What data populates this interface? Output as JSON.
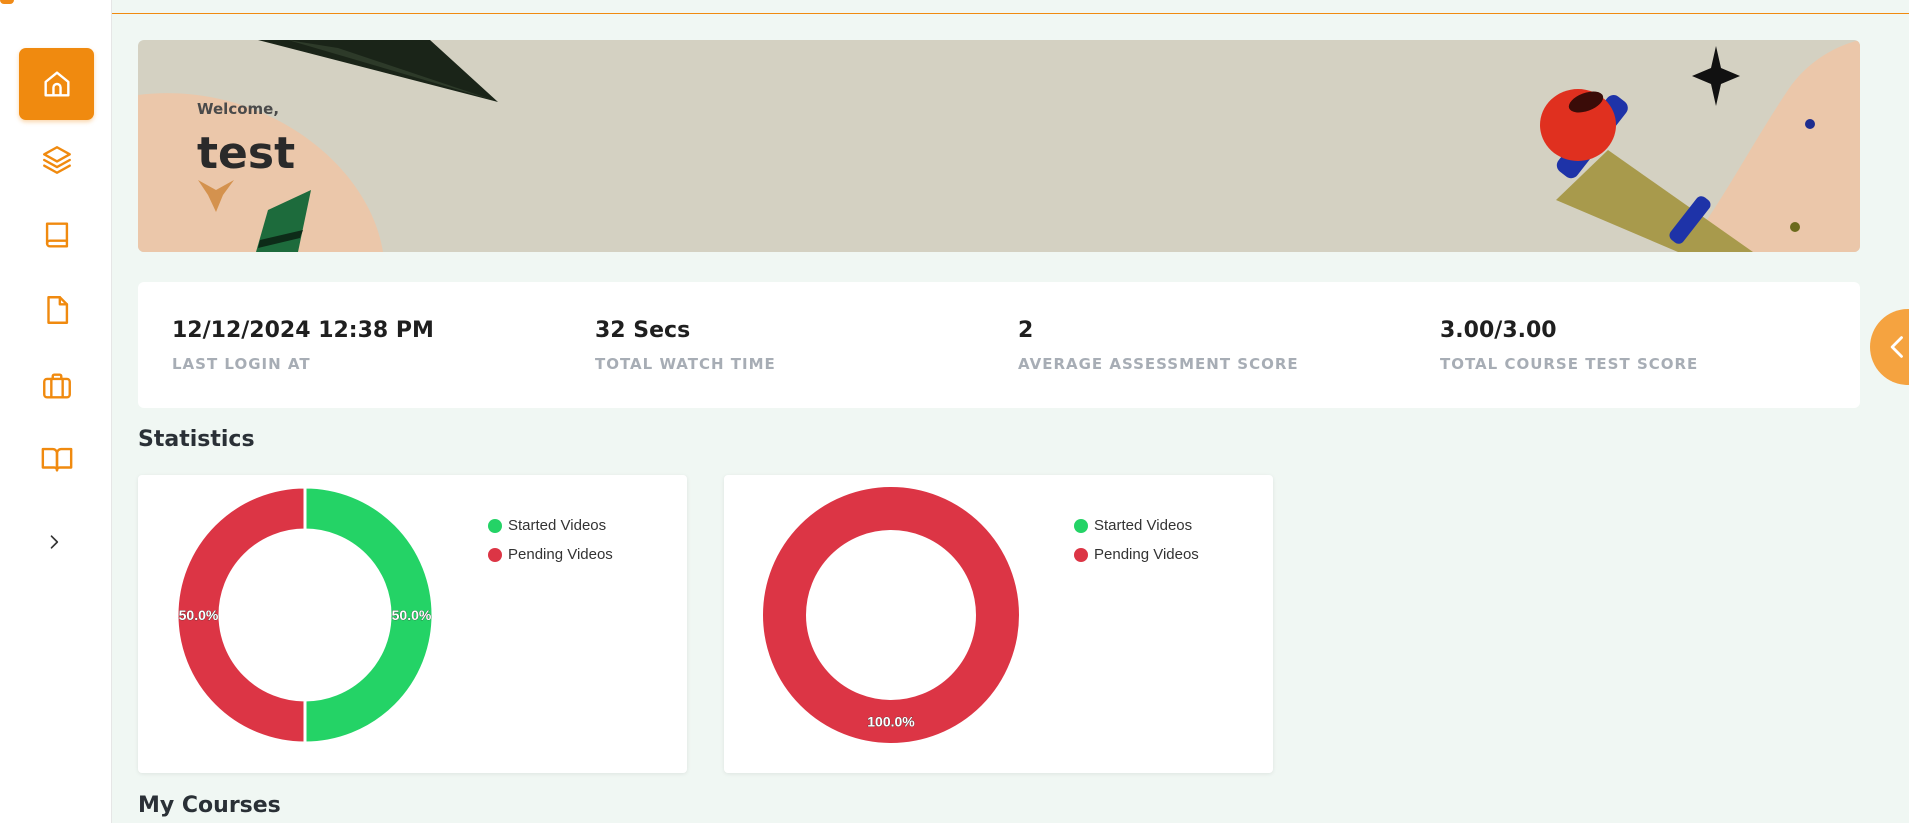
{
  "colors": {
    "accent": "#f08a0f",
    "started": "#24d366",
    "pending": "#dc3545"
  },
  "sidebar": {
    "items": [
      {
        "icon": "home-icon",
        "active": true
      },
      {
        "icon": "layers-icon",
        "active": false
      },
      {
        "icon": "book-icon",
        "active": false
      },
      {
        "icon": "file-icon",
        "active": false
      },
      {
        "icon": "briefcase-icon",
        "active": false
      },
      {
        "icon": "open-book-icon",
        "active": false
      }
    ],
    "expand_icon": "chevron-right-icon"
  },
  "banner": {
    "welcome": "Welcome,",
    "username": "test"
  },
  "stats": [
    {
      "value": "12/12/2024 12:38 PM",
      "label": "LAST LOGIN AT"
    },
    {
      "value": "32 Secs",
      "label": "TOTAL WATCH TIME"
    },
    {
      "value": "2",
      "label": "AVERAGE ASSESSMENT SCORE"
    },
    {
      "value": "3.00/3.00",
      "label": "TOTAL COURSE TEST SCORE"
    }
  ],
  "side_toggle_icon": "chevron-left-icon",
  "sections": {
    "statistics": "Statistics",
    "my_courses": "My Courses"
  },
  "chart_data": [
    {
      "type": "pie",
      "donut": true,
      "categories": [
        "Started Videos",
        "Pending Videos"
      ],
      "values": [
        50.0,
        50.0
      ],
      "labels": [
        "50.0%",
        "50.0%"
      ],
      "legend": "top-right"
    },
    {
      "type": "pie",
      "donut": true,
      "categories": [
        "Started Videos",
        "Pending Videos"
      ],
      "values": [
        0.0,
        100.0
      ],
      "labels": [
        "",
        "100.0%"
      ],
      "legend": "top-right"
    }
  ]
}
